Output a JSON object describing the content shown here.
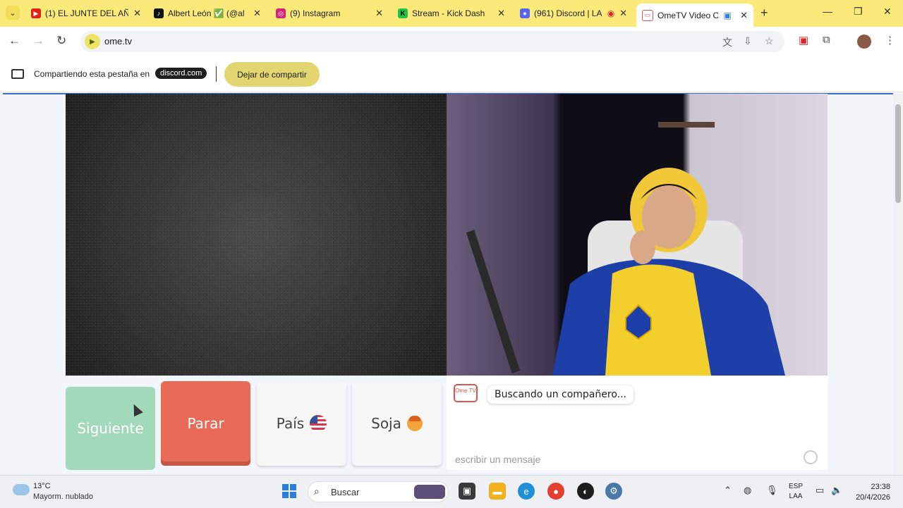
{
  "browser": {
    "tabs": [
      {
        "title": "(1) EL JUNTE DEL AÑ",
        "favicon": "youtube-icon",
        "color": "#e62117"
      },
      {
        "title": "Albert León ✅ (@al",
        "favicon": "tiktok-icon",
        "color": "#111111"
      },
      {
        "title": "(9) Instagram",
        "favicon": "instagram-icon",
        "color": "#d6247a"
      },
      {
        "title": "Stream - Kick Dashbo",
        "favicon": "kick-icon",
        "color": "#22c24a"
      },
      {
        "title": "(961) Discord | LA",
        "favicon": "discord-icon",
        "color": "#5865f2"
      },
      {
        "title": "OmeTV Video Ch",
        "favicon": "ometv-icon",
        "color": "#d9534f",
        "active": true
      }
    ],
    "url": "ome.tv"
  },
  "share_banner": {
    "text": "Compartiendo esta pestaña en",
    "domain": "discord.com",
    "stop_label": "Dejar de compartir"
  },
  "controls": {
    "next_label": "Siguiente",
    "stop_label": "Parar",
    "country_label": "País",
    "gender_label": "Soja"
  },
  "chat": {
    "logo_text": "Ome TV",
    "status_message": "Buscando un compañero...",
    "input_placeholder": "escribir un mensaje"
  },
  "taskbar": {
    "weather_temp": "13°C",
    "weather_desc": "Mayorm. nublado",
    "search_label": "Buscar",
    "lang_top": "ESP",
    "lang_bottom": "LAA",
    "time": "23:38",
    "date": "20/4/2026"
  },
  "colors": {
    "tabstrip": "#fbe97a",
    "stop_button": "#e86a57",
    "next_button": "#a3d9bb",
    "share_button": "#e3d671"
  }
}
